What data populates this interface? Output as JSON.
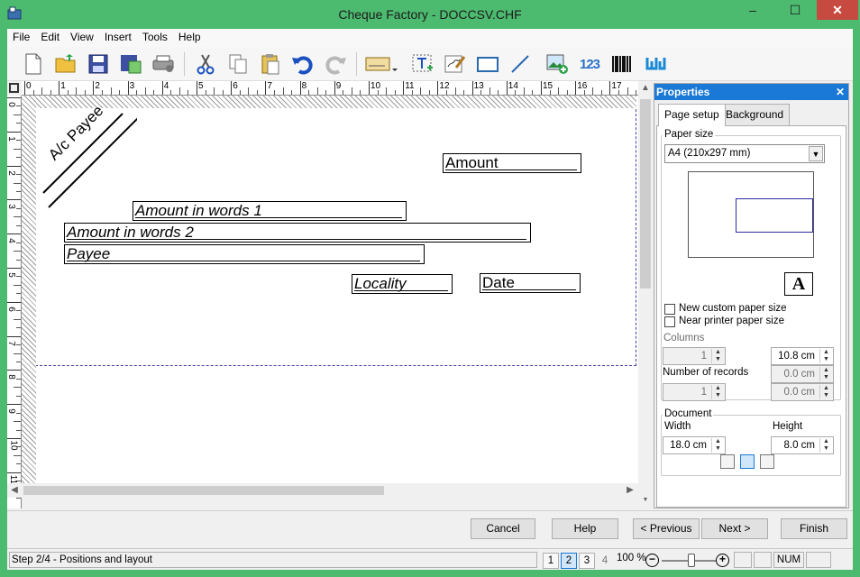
{
  "window": {
    "title": "Cheque Factory - DOCCSV.CHF",
    "minimize": "–",
    "maximize": "☐",
    "close": "✕"
  },
  "menu": [
    "File",
    "Edit",
    "View",
    "Insert",
    "Tools",
    "Help"
  ],
  "toolbar": {
    "new": "new-document-icon",
    "open": "open-folder-icon",
    "save": "save-icon",
    "text_tool": "123"
  },
  "ruler": {
    "h_numbers": [
      "0",
      "1",
      "2",
      "3",
      "4",
      "5",
      "6",
      "7",
      "8",
      "9",
      "10",
      "11",
      "12",
      "13",
      "14",
      "15",
      "16",
      "17"
    ],
    "v_numbers": [
      "0",
      "1",
      "2",
      "3",
      "4",
      "5",
      "6",
      "7",
      "8",
      "9",
      "10",
      "11"
    ]
  },
  "cheque": {
    "ac_payee": "A/c Payee",
    "amount": "Amount",
    "amount_words_1": "Amount in words 1",
    "amount_words_2": "Amount in words 2",
    "payee": "Payee",
    "locality": "Locality",
    "date": "Date"
  },
  "properties": {
    "title": "Properties",
    "close": "✕",
    "tabs": [
      "Page setup",
      "Background"
    ],
    "paper_size_label": "Paper size",
    "paper_size_value": "A4 (210x297 mm)",
    "orientation_glyph": "A",
    "custom_paper": "New custom paper size",
    "near_printer": "Near printer paper size",
    "columns_label": "Columns",
    "columns_value": "1",
    "column_width": "10.8 cm",
    "records_label": "Number of records",
    "records_value": "1",
    "records_gap_1": "0.0 cm",
    "records_gap_2": "0.0 cm",
    "document_label": "Document",
    "width_label": "Width",
    "height_label": "Height",
    "width_value": "18.0 cm",
    "height_value": "8.0 cm"
  },
  "buttons": {
    "cancel": "Cancel",
    "help": "Help",
    "previous": "< Previous",
    "next": "Next >",
    "finish": "Finish"
  },
  "status": {
    "text": "Step 2/4 - Positions and layout",
    "pages": [
      "1",
      "2",
      "3",
      "4"
    ],
    "active_page": "2",
    "zoom": "100 %",
    "num": "NUM"
  },
  "colors": {
    "titlebar": "#4cba6f",
    "accent": "#1a78d6",
    "close": "#c74a40"
  }
}
